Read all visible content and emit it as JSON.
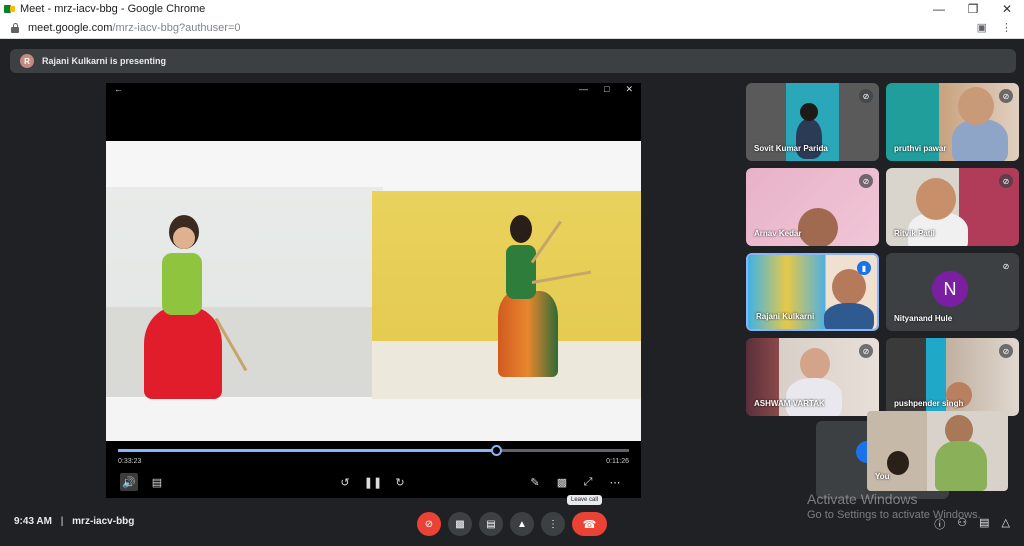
{
  "browser": {
    "window_title": "Meet - mrz-iacv-bbg - Google Chrome",
    "url_host": "meet.google.com",
    "url_path": "/mrz-iacv-bbg?authuser=0"
  },
  "banner": {
    "avatar_letter": "R",
    "text": "Rajani Kulkarni is presenting"
  },
  "player": {
    "current_time": "0:33:23",
    "duration": "0:11:26",
    "progress_fraction": 0.74
  },
  "participants": [
    {
      "name": "Sovit Kumar Parida",
      "muted": true
    },
    {
      "name": "pruthvi pawar",
      "muted": true
    },
    {
      "name": "Arnav Kedar",
      "muted": true
    },
    {
      "name": "Ritvik Patil",
      "muted": true
    },
    {
      "name": "Rajani Kulkarni",
      "muted": false
    },
    {
      "name": "Nityanand Hule",
      "muted": true,
      "avatar_letter": "N"
    },
    {
      "name": "ASHWAM VARTAK",
      "muted": true
    },
    {
      "name": "pushpender singh",
      "muted": true
    }
  ],
  "self_view": {
    "name": "You"
  },
  "bottom": {
    "time": "9:43 AM",
    "separator": "|",
    "meeting_code": "mrz-iacv-bbg",
    "leave_tooltip": "Leave call"
  },
  "watermark": {
    "line1": "Activate Windows",
    "line2": "Go to Settings to activate Windows."
  },
  "colors": {
    "background": "#202124",
    "tile": "#3c4043",
    "danger": "#ea4335",
    "accent": "#8ab4f8",
    "avatar_purple": "#7b1fa2"
  }
}
